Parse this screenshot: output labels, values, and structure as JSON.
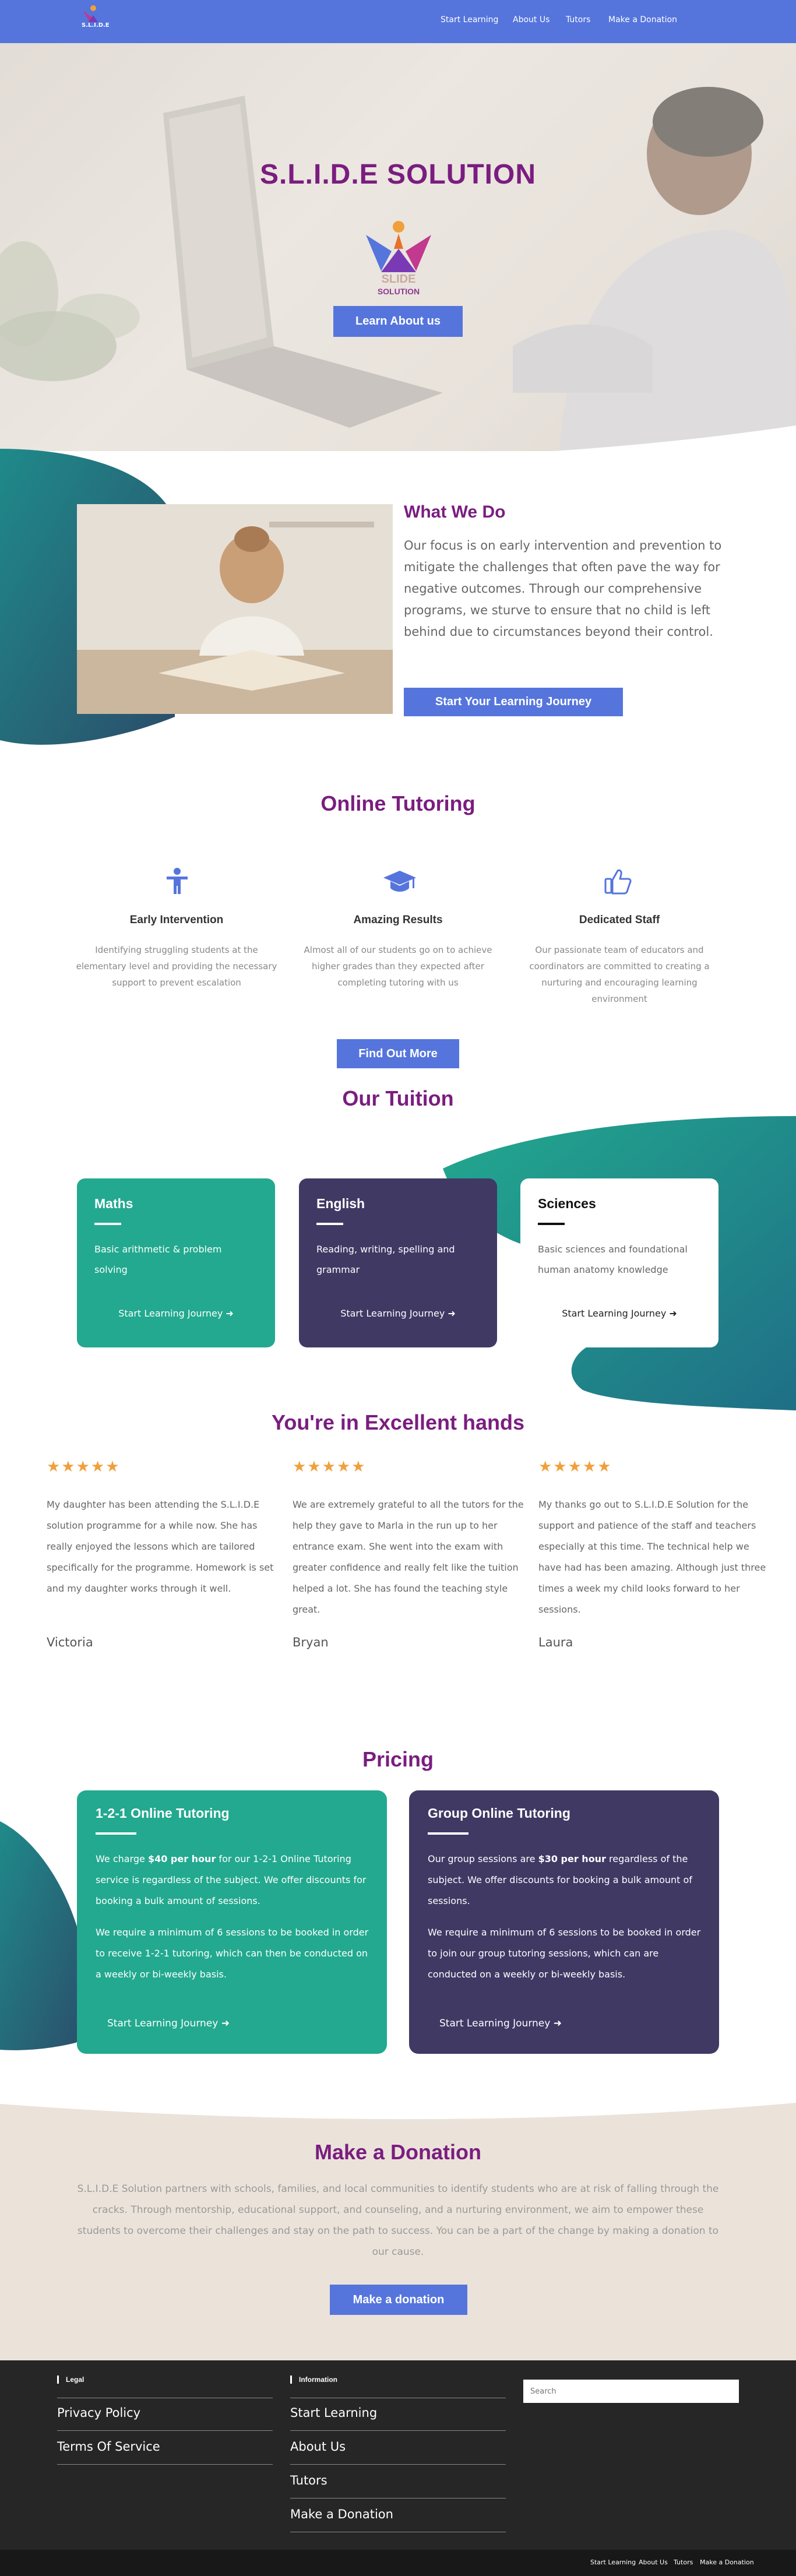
{
  "header": {
    "logo_text": "S.L.I.D.E",
    "nav": [
      "Start Learning",
      "About Us",
      "Tutors",
      "Make a Donation"
    ]
  },
  "hero": {
    "title": "S.L.I.D.E SOLUTION",
    "logo_caption": "SOLUTION",
    "button": "Learn About us"
  },
  "what_we_do": {
    "title": "What We Do",
    "text": "Our focus is on early intervention and prevention to mitigate the challenges that often pave the way for negative outcomes. Through our comprehensive programs, we sturve to ensure that no child is left behind due to circumstances beyond their control.",
    "button": "Start Your Learning Journey"
  },
  "online_tutoring": {
    "title": "Online Tutoring",
    "features": [
      {
        "icon": "person-icon",
        "title": "Early Intervention",
        "text": "Identifying struggling students at the elementary level and providing the necessary support to prevent escalation"
      },
      {
        "icon": "graduation-cap-icon",
        "title": "Amazing Results",
        "text": "Almost all of our students go on to achieve higher grades than they expected after completing tutoring with us"
      },
      {
        "icon": "thumbs-up-icon",
        "title": "Dedicated Staff",
        "text": "Our passionate team of educators and coordinators are committed to creating a nurturing and encouraging learning environment"
      }
    ],
    "button": "Find Out More"
  },
  "tuition": {
    "title": "Our Tuition",
    "cards": [
      {
        "title": "Maths",
        "text": "Basic arithmetic & problem solving",
        "link": "Start Learning Journey"
      },
      {
        "title": "English",
        "text": "Reading, writing, spelling and grammar",
        "link": "Start Learning Journey"
      },
      {
        "title": "Sciences",
        "text": "Basic sciences and foundational human anatomy knowledge",
        "link": "Start Learning Journey"
      }
    ],
    "colors": {
      "maths": "#22a98f",
      "english": "#3f3964",
      "sciences": "#ffffff"
    }
  },
  "testimonials": {
    "title": "You're in Excellent hands",
    "stars": "★★★★★",
    "items": [
      {
        "text": "My daughter has been attending the S.L.I.D.E solution programme for a while now. She has really enjoyed the lessons which are tailored specifically for the programme. Homework is set and my daughter works through it well.",
        "name": "Victoria"
      },
      {
        "text": "We are extremely grateful to all the tutors for the help they gave to Marla in the run up to her entrance exam. She went into the exam with greater confidence and really felt like the tuition helped a lot. She has found the teaching style great.",
        "name": "Bryan"
      },
      {
        "text": "My thanks go out to S.L.I.D.E Solution for the support and patience of the staff and teachers especially at this time. The technical help we have had has been amazing. Although just three times a week my child looks forward to her sessions.",
        "name": "Laura"
      }
    ]
  },
  "pricing": {
    "title": "Pricing",
    "cards": [
      {
        "title": "1-2-1 Online Tutoring",
        "p1_pre": "We charge ",
        "p1_bold": "$40 per hour",
        "p1_post": " for our 1-2-1 Online Tutoring service is regardless of the subject. We offer discounts for booking a bulk amount of sessions.",
        "p2": "We require a minimum of 6 sessions to be booked in order to receive 1-2-1 tutoring, which can then be conducted on a weekly or bi-weekly basis.",
        "link": "Start Learning Journey"
      },
      {
        "title": "Group Online Tutoring",
        "p1_pre": "Our group sessions are ",
        "p1_bold": "$30 per hour",
        "p1_post": " regardless of the subject. We offer discounts for booking a bulk amount of sessions.",
        "p2": "We require a minimum of 6 sessions to be booked in order to join our group tutoring sessions, which can are conducted on a weekly or bi-weekly basis.",
        "link": "Start Learning Journey"
      }
    ]
  },
  "donation": {
    "title": "Make a Donation",
    "text": "S.L.I.D.E Solution partners with schools, families, and local communities to identify students who are at risk of falling through the cracks. Through mentorship, educational support, and counseling, and a nurturing environment, we aim to empower these students to overcome their challenges and stay on the path to success. You can be a part of the change by making a donation to our cause.",
    "button": "Make a donation"
  },
  "footer": {
    "legal_heading": "Legal",
    "legal_links": [
      "Privacy Policy",
      "Terms Of Service"
    ],
    "info_heading": "Information",
    "info_links": [
      "Start Learning",
      "About Us",
      "Tutors",
      "Make a Donation"
    ],
    "search_placeholder": "Search",
    "bottom_links": [
      "Start Learning",
      "About Us",
      "Tutors",
      "Make a Donation"
    ]
  }
}
